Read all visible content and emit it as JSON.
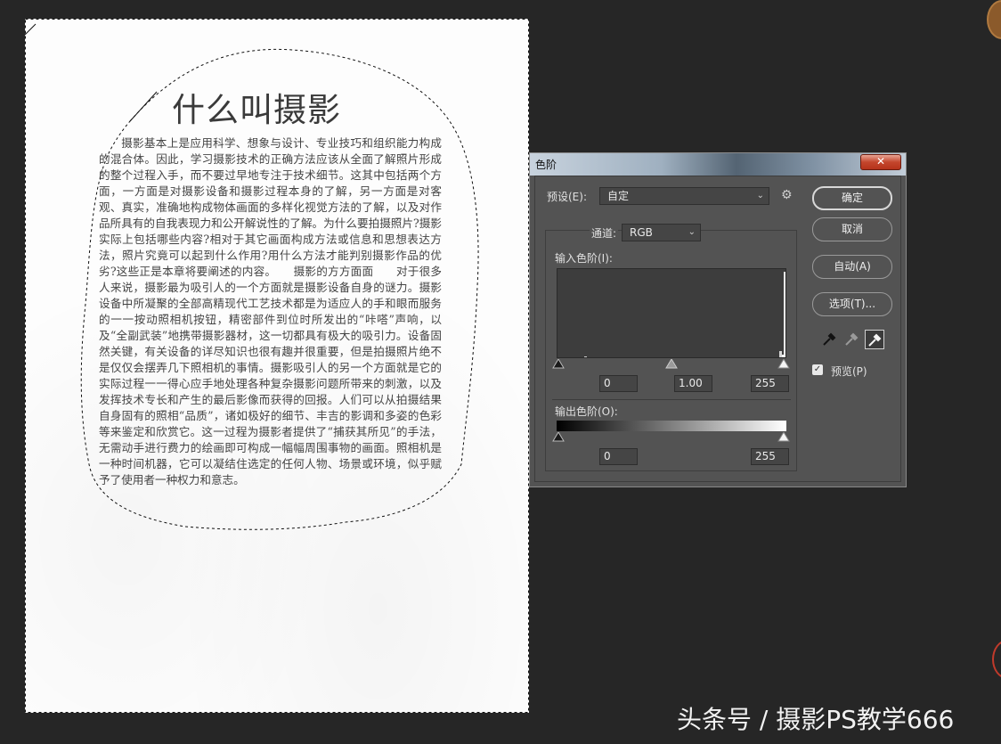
{
  "document": {
    "title": "什么叫摄影",
    "body": "摄影基本上是应用科学、想象与设计、专业技巧和组织能力构成的混合体。因此，学习摄影技术的正确方法应该从全面了解照片形成的整个过程入手，而不要过早地专注于技术细节。这其中包括两个方面，一方面是对摄影设备和摄影过程本身的了解，另一方面是对客观、真实，准确地构成物体画面的多样化视觉方法的了解，以及对作品所具有的自我表现力和公开解说性的了解。为什么要拍摄照片?摄影实际上包括哪些内容?相对于其它画面构成方法或信息和思想表达方法，照片究竟可以起到什么作用?用什么方法才能判别摄影作品的优劣?这些正是本章将要阐述的内容。　　摄影的方方面面　　对于很多人来说，摄影最为吸引人的一个方面就是摄影设备自身的谜力。摄影设备中所凝聚的全部高精现代工艺技术都是为适应人的手和眼而服务的一一按动照相机按钮，精密部件到位时所发出的“咔嗒”声响，以及“全副武装”地携带摄影器材，这一切都具有极大的吸引力。设备固然关键，有关设备的详尽知识也很有趣并很重要，但是拍摄照片绝不是仅仅会摆弄几下照相机的事情。摄影吸引人的另一个方面就是它的实际过程一一得心应手地处理各种复杂摄影问题所带来的刺激，以及发挥技术专长和产生的最后影像而获得的回报。人们可以从拍摄结果自身固有的照相“品质”，诸如极好的细节、丰吉的影调和多姿的色彩等来鉴定和欣赏它。这一过程为摄影者提供了“捕获其所见”的手法，无需动手进行费力的绘画即可构成一幅幅周围事物的画面。照相机是一种时间机器，它可以凝结住选定的任何人物、场景或环境，似乎赋予了使用者一种权力和意志。"
  },
  "dialog": {
    "title": "色阶",
    "close_icon": "x-icon",
    "preset_label": "预设(E):",
    "preset_value": "自定",
    "preset_options_icon": "gear-icon",
    "channel_label": "通道:",
    "channel_value": "RGB",
    "input_levels_label": "输入色阶(I):",
    "input_black": "0",
    "input_gamma": "1.00",
    "input_white": "255",
    "output_levels_label": "输出色阶(O):",
    "output_black": "0",
    "output_white": "255",
    "buttons": {
      "ok": "确定",
      "cancel": "取消",
      "auto": "自动(A)",
      "options": "选项(T)..."
    },
    "eyedroppers": [
      "black-eyedropper-icon",
      "gray-eyedropper-icon",
      "white-eyedropper-icon"
    ],
    "preview_label": "预览(P)",
    "preview_checked": true
  },
  "watermark": "头条号 / 摄影PS教学666"
}
